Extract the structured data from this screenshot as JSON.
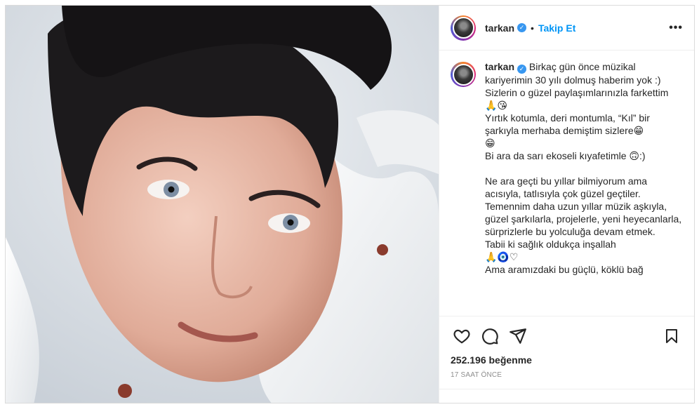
{
  "post": {
    "photo_alt": "",
    "header": {
      "username": "tarkan",
      "separator": "•",
      "follow_label": "Takip Et",
      "more_label": "•••"
    },
    "caption": {
      "username": "tarkan",
      "text": " Birkaç gün önce müzikal kariyerimin 30 yılı dolmuş haberim yok :)\nSizlerin o güzel paylaşımlarınızla farkettim\n🙏😘\nYırtık kotumla, deri montumla, “Kıl” bir şarkıyla merhaba demiştim sizlere😁\n😁\nBi ara da sarı ekoseli kıyafetimle 🙃:)\n\nNe ara geçti bu yıllar bilmiyorum ama acısıyla, tatlısıyla çok güzel geçtiler.\nTemennim daha uzun yıllar müzik aşkıyla, güzel şarkılarla, projelerle, yeni heyecanlarla, sürprizlerle bu yolculuğa devam etmek.\nTabii ki sağlık oldukça inşallah\n🙏🧿♡\nAma aramızdaki bu güçlü, köklü bağ"
    },
    "likes": "252.196 beğenme",
    "timestamp": "17 saat önce",
    "icons": [
      "heart-icon",
      "comment-icon",
      "share-icon",
      "bookmark-icon"
    ],
    "colors": {
      "follow": "#0095f6",
      "verified": "#3897f0",
      "text": "#262626",
      "muted": "#8e8e8e"
    }
  }
}
